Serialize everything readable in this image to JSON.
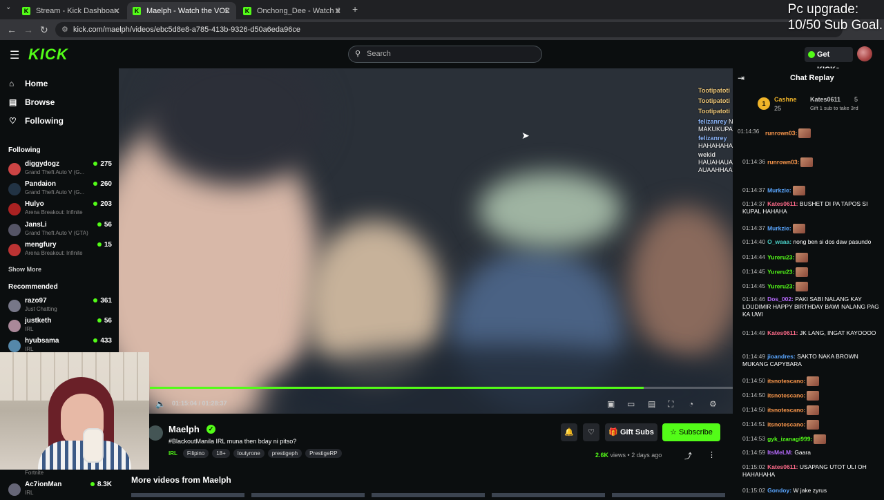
{
  "browser": {
    "tabs": [
      {
        "title": "Stream - Kick Dashboard",
        "active": false
      },
      {
        "title": "Maelph - Watch the VOD on Kick",
        "active": true
      },
      {
        "title": "Onchong_Dee - Watch the VOD",
        "active": false
      }
    ],
    "url": "kick.com/maelph/videos/ebc5d8e8-a785-413b-9326-d50a6eda96ce"
  },
  "overlay_goal": {
    "line1": "Pc upgrade:",
    "line2": "10/50 Sub Goal."
  },
  "header": {
    "search_placeholder": "Search",
    "get_kicks": "Get KICKs",
    "logo": "KICK"
  },
  "sidebar": {
    "nav": [
      {
        "label": "Home",
        "icon": "home-icon"
      },
      {
        "label": "Browse",
        "icon": "browse-icon"
      },
      {
        "label": "Following",
        "icon": "heart-icon"
      }
    ],
    "following_heading": "Following",
    "following": [
      {
        "name": "diggydogz",
        "game": "Grand Theft Auto V (G...",
        "viewers": "275"
      },
      {
        "name": "Pandaion",
        "game": "Grand Theft Auto V (G...",
        "viewers": "260"
      },
      {
        "name": "Hulyo",
        "game": "Arena Breakout: Infinite",
        "viewers": "203"
      },
      {
        "name": "JansLi",
        "game": "Grand Theft Auto V (GTA)",
        "viewers": "56"
      },
      {
        "name": "mengfury",
        "game": "Arena Breakout: Infinite",
        "viewers": "15"
      }
    ],
    "show_more": "Show More",
    "recommended_heading": "Recommended",
    "recommended": [
      {
        "name": "razo97",
        "game": "Just Chatting",
        "viewers": "361"
      },
      {
        "name": "justketh",
        "game": "IRL",
        "viewers": "56"
      },
      {
        "name": "hyubsama",
        "game": "IRL",
        "viewers": "433"
      }
    ],
    "bottom": [
      {
        "name": "",
        "game": "Fortnite",
        "viewers": ""
      },
      {
        "name": "Ac7ionMan",
        "game": "IRL",
        "viewers": "8.3K"
      }
    ]
  },
  "player": {
    "time": "01:15:04 / 01:28:37",
    "progress": 0.847,
    "overlay_chat": [
      {
        "user": "Tootipatoti",
        "text": ""
      },
      {
        "user": "Tootipatoti",
        "text": ""
      },
      {
        "user": "Tootipatoti",
        "text": ""
      },
      {
        "user": "felizanrey",
        "text": "NAHIHIYA PA YON FIRST TIME E, SA SUSUNOD MAKUKUPAL KA NA"
      },
      {
        "user": "felizanrey",
        "text": "HAHAHAHAHAHAHAHAHAHAHAHAHAHAHAHAHAHAHA HA"
      },
      {
        "user": "wekid",
        "text": "HAUAHAUAHAUAHAUAHAUAHAUAHAUAHAUAAHUAH AUAAHHAAH una agad nasa isip may kamukhang cartoon e"
      }
    ]
  },
  "stream": {
    "name": "Maelph",
    "title": "#BlackoutManila IRL muna then bday ni pitso?",
    "category": "IRL",
    "tags": [
      "Filipino",
      "18+",
      "loutyrone",
      "prestigeph",
      "PrestigeRP"
    ],
    "gift_subs": "Gift Subs",
    "subscribe": "Subscribe",
    "views": "2.6K",
    "views_label": "views",
    "ago": "2 days ago",
    "more_videos": "More videos from Maelph"
  },
  "chat": {
    "title": "Chat Replay",
    "pinned": {
      "rank": "1",
      "user1": "Cashne",
      "user1_count": "25",
      "user2": "Kates0611",
      "user2_count": "5",
      "note": "Gift 1 sub to take 3rd"
    },
    "messages": [
      {
        "time": "01:14:36",
        "user": "runrown03:",
        "color": "#ff9a4d",
        "text": "",
        "emote": true
      },
      {
        "time": "01:14:36",
        "user": "runrown03:",
        "color": "#ff9a4d",
        "text": "",
        "emote": true
      },
      {
        "time": "01:14:37",
        "user": "Murkzie:",
        "color": "#5aa6ff",
        "text": "",
        "emote": true
      },
      {
        "time": "01:14:37",
        "user": "Kates0611:",
        "color": "#ff6b8a",
        "text": "BUSHET DI PA TAPOS SI KUPAL HAHAHA",
        "emote": false
      },
      {
        "time": "01:14:37",
        "user": "Murkzie:",
        "color": "#5aa6ff",
        "text": "",
        "emote": true
      },
      {
        "time": "01:14:40",
        "user": "O_waaa:",
        "color": "#4ad1c8",
        "text": "nong ben si dos daw pasundo",
        "emote": false
      },
      {
        "time": "01:14:44",
        "user": "Yureru23:",
        "color": "#53fc18",
        "text": "",
        "emote": true
      },
      {
        "time": "01:14:45",
        "user": "Yureru23:",
        "color": "#53fc18",
        "text": "",
        "emote": true
      },
      {
        "time": "01:14:45",
        "user": "Yureru23:",
        "color": "#53fc18",
        "text": "",
        "emote": true
      },
      {
        "time": "01:14:46",
        "user": "Dos_002:",
        "color": "#b86bff",
        "text": "PAKI SABI NALANG KAY LOUDIMIR HAPPY BIRTHDAY BAWI NALANG PAG KA UWI",
        "emote": false
      },
      {
        "time": "01:14:49",
        "user": "Kates0611:",
        "color": "#ff6b8a",
        "text": "JK LANG, INGAT KAYOOOO",
        "emote": false
      },
      {
        "time": "01:14:49",
        "user": "jioandres:",
        "color": "#5aa6ff",
        "text": "SAKTO NAKA BROWN MUKANG CAPYBARA",
        "emote": false
      },
      {
        "time": "01:14:50",
        "user": "itsnotescano:",
        "color": "#ff9a4d",
        "text": "",
        "emote": true
      },
      {
        "time": "01:14:50",
        "user": "itsnotescano:",
        "color": "#ff9a4d",
        "text": "",
        "emote": true
      },
      {
        "time": "01:14:50",
        "user": "itsnotescano:",
        "color": "#ff9a4d",
        "text": "",
        "emote": true
      },
      {
        "time": "01:14:51",
        "user": "itsnotescano:",
        "color": "#ff9a4d",
        "text": "",
        "emote": true
      },
      {
        "time": "01:14:53",
        "user": "gyk_izanagi999:",
        "color": "#53fc18",
        "text": "",
        "emote": true
      },
      {
        "time": "01:14:59",
        "user": "ItsMeLM:",
        "color": "#b86bff",
        "text": "Gaara",
        "emote": false
      },
      {
        "time": "01:15:02",
        "user": "Kates0611:",
        "color": "#ff6b8a",
        "text": "USAPANG UTOT ULI OH HAHAHAHA",
        "emote": false
      },
      {
        "time": "01:15:02",
        "user": "Gondoy:",
        "color": "#5aa6ff",
        "text": "W jake zyrus",
        "emote": false
      }
    ]
  }
}
